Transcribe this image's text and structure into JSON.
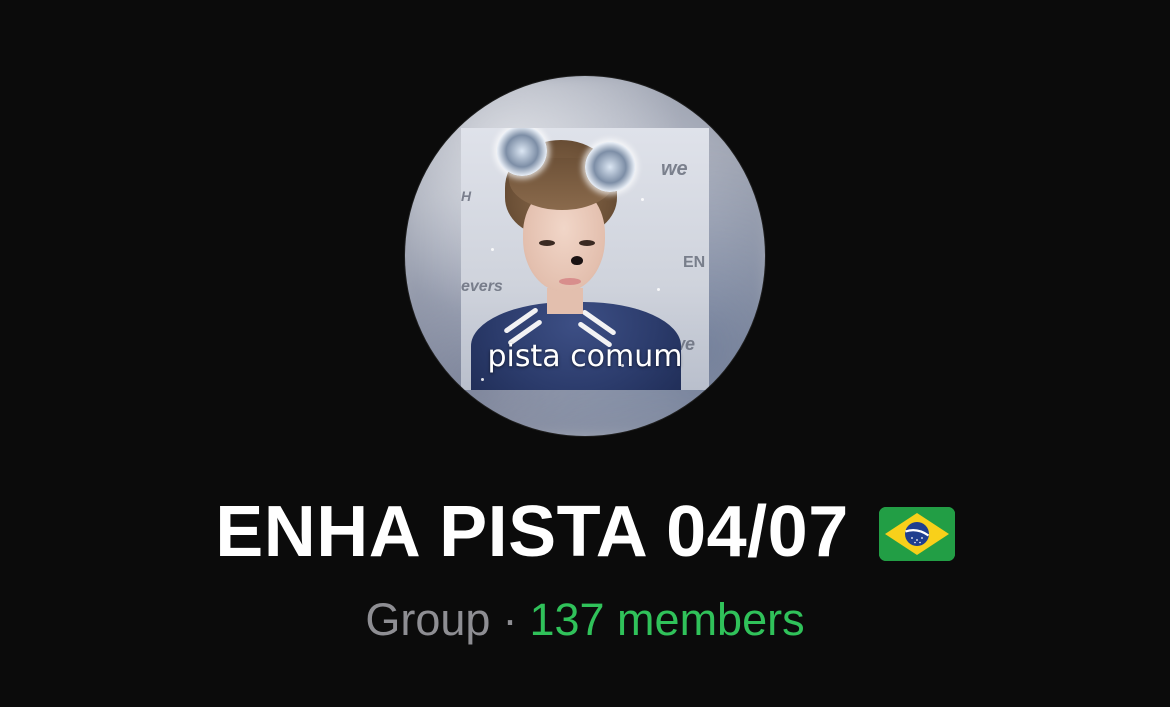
{
  "group": {
    "avatar_caption": "pista comum",
    "name": "ENHA PISTA 04/07",
    "flag_icon": "brazil-flag-icon",
    "type": "Group",
    "separator": "·",
    "members": "137 members"
  },
  "colors": {
    "background": "#0b0b0b",
    "title": "#ffffff",
    "type_label": "#8e8e93",
    "members_accent": "#30c25a"
  }
}
